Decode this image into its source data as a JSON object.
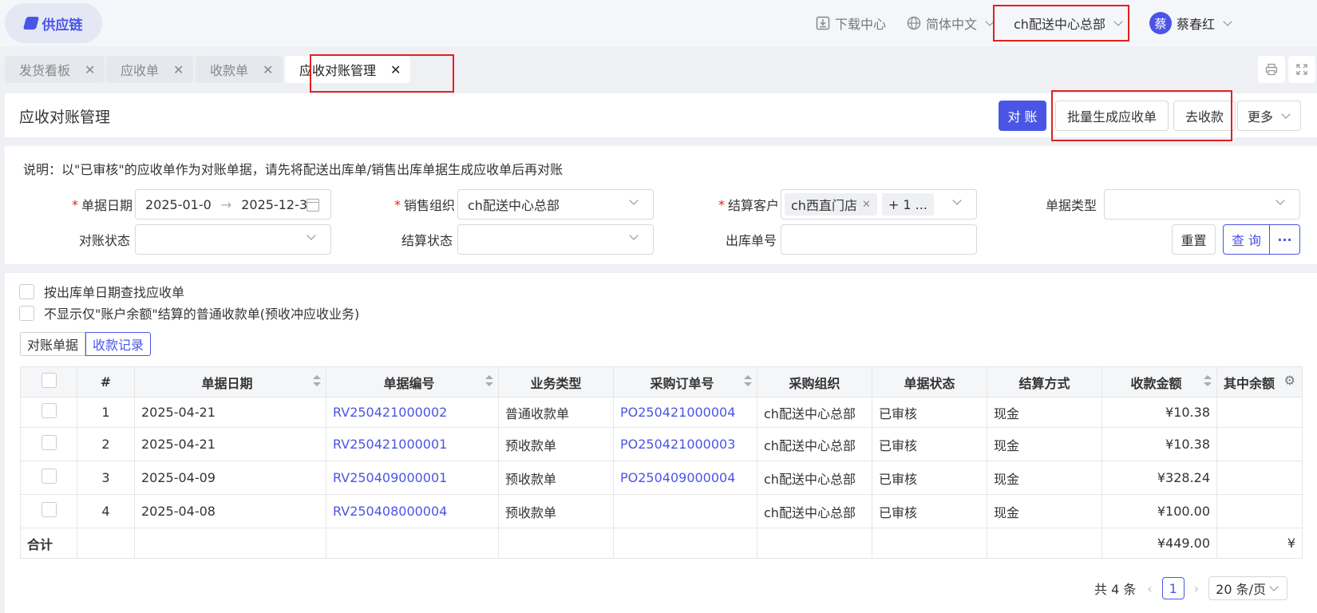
{
  "app": {
    "logo_text": "供应链"
  },
  "topbar": {
    "download": "下载中心",
    "language": "简体中文",
    "org": "ch配送中心总部",
    "avatar_char": "蔡",
    "user": "蔡春红"
  },
  "tabs": [
    {
      "label": "发货看板"
    },
    {
      "label": "应收单"
    },
    {
      "label": "收款单"
    },
    {
      "label": "应收对账管理"
    }
  ],
  "page": {
    "title": "应收对账管理",
    "btn_reconcile": "对 账",
    "btn_batch": "批量生成应收单",
    "btn_collect": "去收款",
    "btn_more": "更多"
  },
  "filter": {
    "note": "说明：以\"已审核\"的应收单作为对账单据，请先将配送出库单/销售出库单据生成应收单后再对账",
    "date_label": "单据日期",
    "date_start": "2025-01-0",
    "date_arrow": "→",
    "date_end": "2025-12-3",
    "org_label": "销售组织",
    "org_value": "ch配送中心总部",
    "customer_label": "结算客户",
    "customer_tag": "ch西直门店",
    "customer_more": "+ 1 ...",
    "doctype_label": "单据类型",
    "recon_status_label": "对账状态",
    "settle_status_label": "结算状态",
    "outbound_label": "出库单号",
    "btn_reset": "重置",
    "btn_query": "查 询",
    "btn_query_more": "···"
  },
  "options": {
    "opt1": "按出库单日期查找应收单",
    "opt2": "不显示仅\"账户余额\"结算的普通收款单(预收冲应收业务)"
  },
  "views": {
    "view1": "对账单据",
    "view2": "收款记录"
  },
  "table": {
    "columns": [
      "#",
      "单据日期",
      "单据编号",
      "业务类型",
      "采购订单号",
      "采购组织",
      "单据状态",
      "结算方式",
      "收款金额",
      "其中余额"
    ],
    "rows": [
      {
        "idx": "1",
        "date": "2025-04-21",
        "doc_no": "RV250421000002",
        "biz_type": "普通收款单",
        "po": "PO250421000004",
        "org": "ch配送中心总部",
        "status": "已审核",
        "method": "现金",
        "amount": "¥10.38"
      },
      {
        "idx": "2",
        "date": "2025-04-21",
        "doc_no": "RV250421000001",
        "biz_type": "预收款单",
        "po": "PO250421000003",
        "org": "ch配送中心总部",
        "status": "已审核",
        "method": "现金",
        "amount": "¥10.38"
      },
      {
        "idx": "3",
        "date": "2025-04-09",
        "doc_no": "RV250409000001",
        "biz_type": "预收款单",
        "po": "PO250409000004",
        "org": "ch配送中心总部",
        "status": "已审核",
        "method": "现金",
        "amount": "¥328.24"
      },
      {
        "idx": "4",
        "date": "2025-04-08",
        "doc_no": "RV250408000004",
        "biz_type": "预收款单",
        "po": "",
        "org": "ch配送中心总部",
        "status": "已审核",
        "method": "现金",
        "amount": "¥100.00"
      }
    ],
    "sum_label": "合计",
    "sum_amount": "¥449.00",
    "sum_balance": "¥"
  },
  "pager": {
    "total": "共 4 条",
    "page": "1",
    "page_size": "20 条/页"
  },
  "colors": {
    "accent": "#4a55e6",
    "highlight": "#e32020"
  }
}
